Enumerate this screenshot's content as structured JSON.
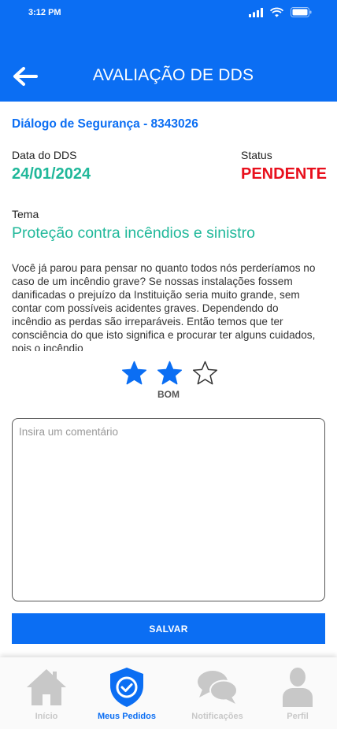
{
  "status_bar": {
    "time": "3:12 PM"
  },
  "header": {
    "title": "AVALIAÇÃO DE DDS",
    "back_icon": "arrow-left-icon"
  },
  "dds": {
    "id_line": "Diálogo de Segurança - 8343026",
    "date_label": "Data do DDS",
    "date_value": "24/01/2024",
    "status_label": "Status",
    "status_value": "PENDENTE",
    "tema_label": "Tema",
    "tema_value": "Proteção contra incêndios e sinistro",
    "description": "Você já parou para pensar no quanto todos nós perderíamos no caso de um incêndio grave? Se nossas instalações fossem danificadas o prejuízo da Instituição seria muito grande, sem contar com possíveis acidentes graves. Dependendo do incêndio as perdas são irreparáveis. Então temos que ter consciência do que isto significa e procurar ter alguns cuidados, pois o incêndio"
  },
  "rating": {
    "value": 2,
    "max": 3,
    "label": "BOM"
  },
  "comment": {
    "placeholder": "Insira um comentário",
    "value": ""
  },
  "save_button": {
    "label": "SALVAR"
  },
  "bottom_nav": {
    "items": [
      {
        "label": "Início",
        "icon": "home-icon",
        "active": false
      },
      {
        "label": "Meus Pedidos",
        "icon": "shield-check-icon",
        "active": true
      },
      {
        "label": "Notificações",
        "icon": "chat-bubbles-icon",
        "active": false
      },
      {
        "label": "Perfil",
        "icon": "user-icon",
        "active": false
      }
    ]
  },
  "colors": {
    "primary": "#0b6ef3",
    "accent_green": "#20b89a",
    "status_red": "#e80f1c",
    "inactive_nav": "#c8c8c8"
  }
}
